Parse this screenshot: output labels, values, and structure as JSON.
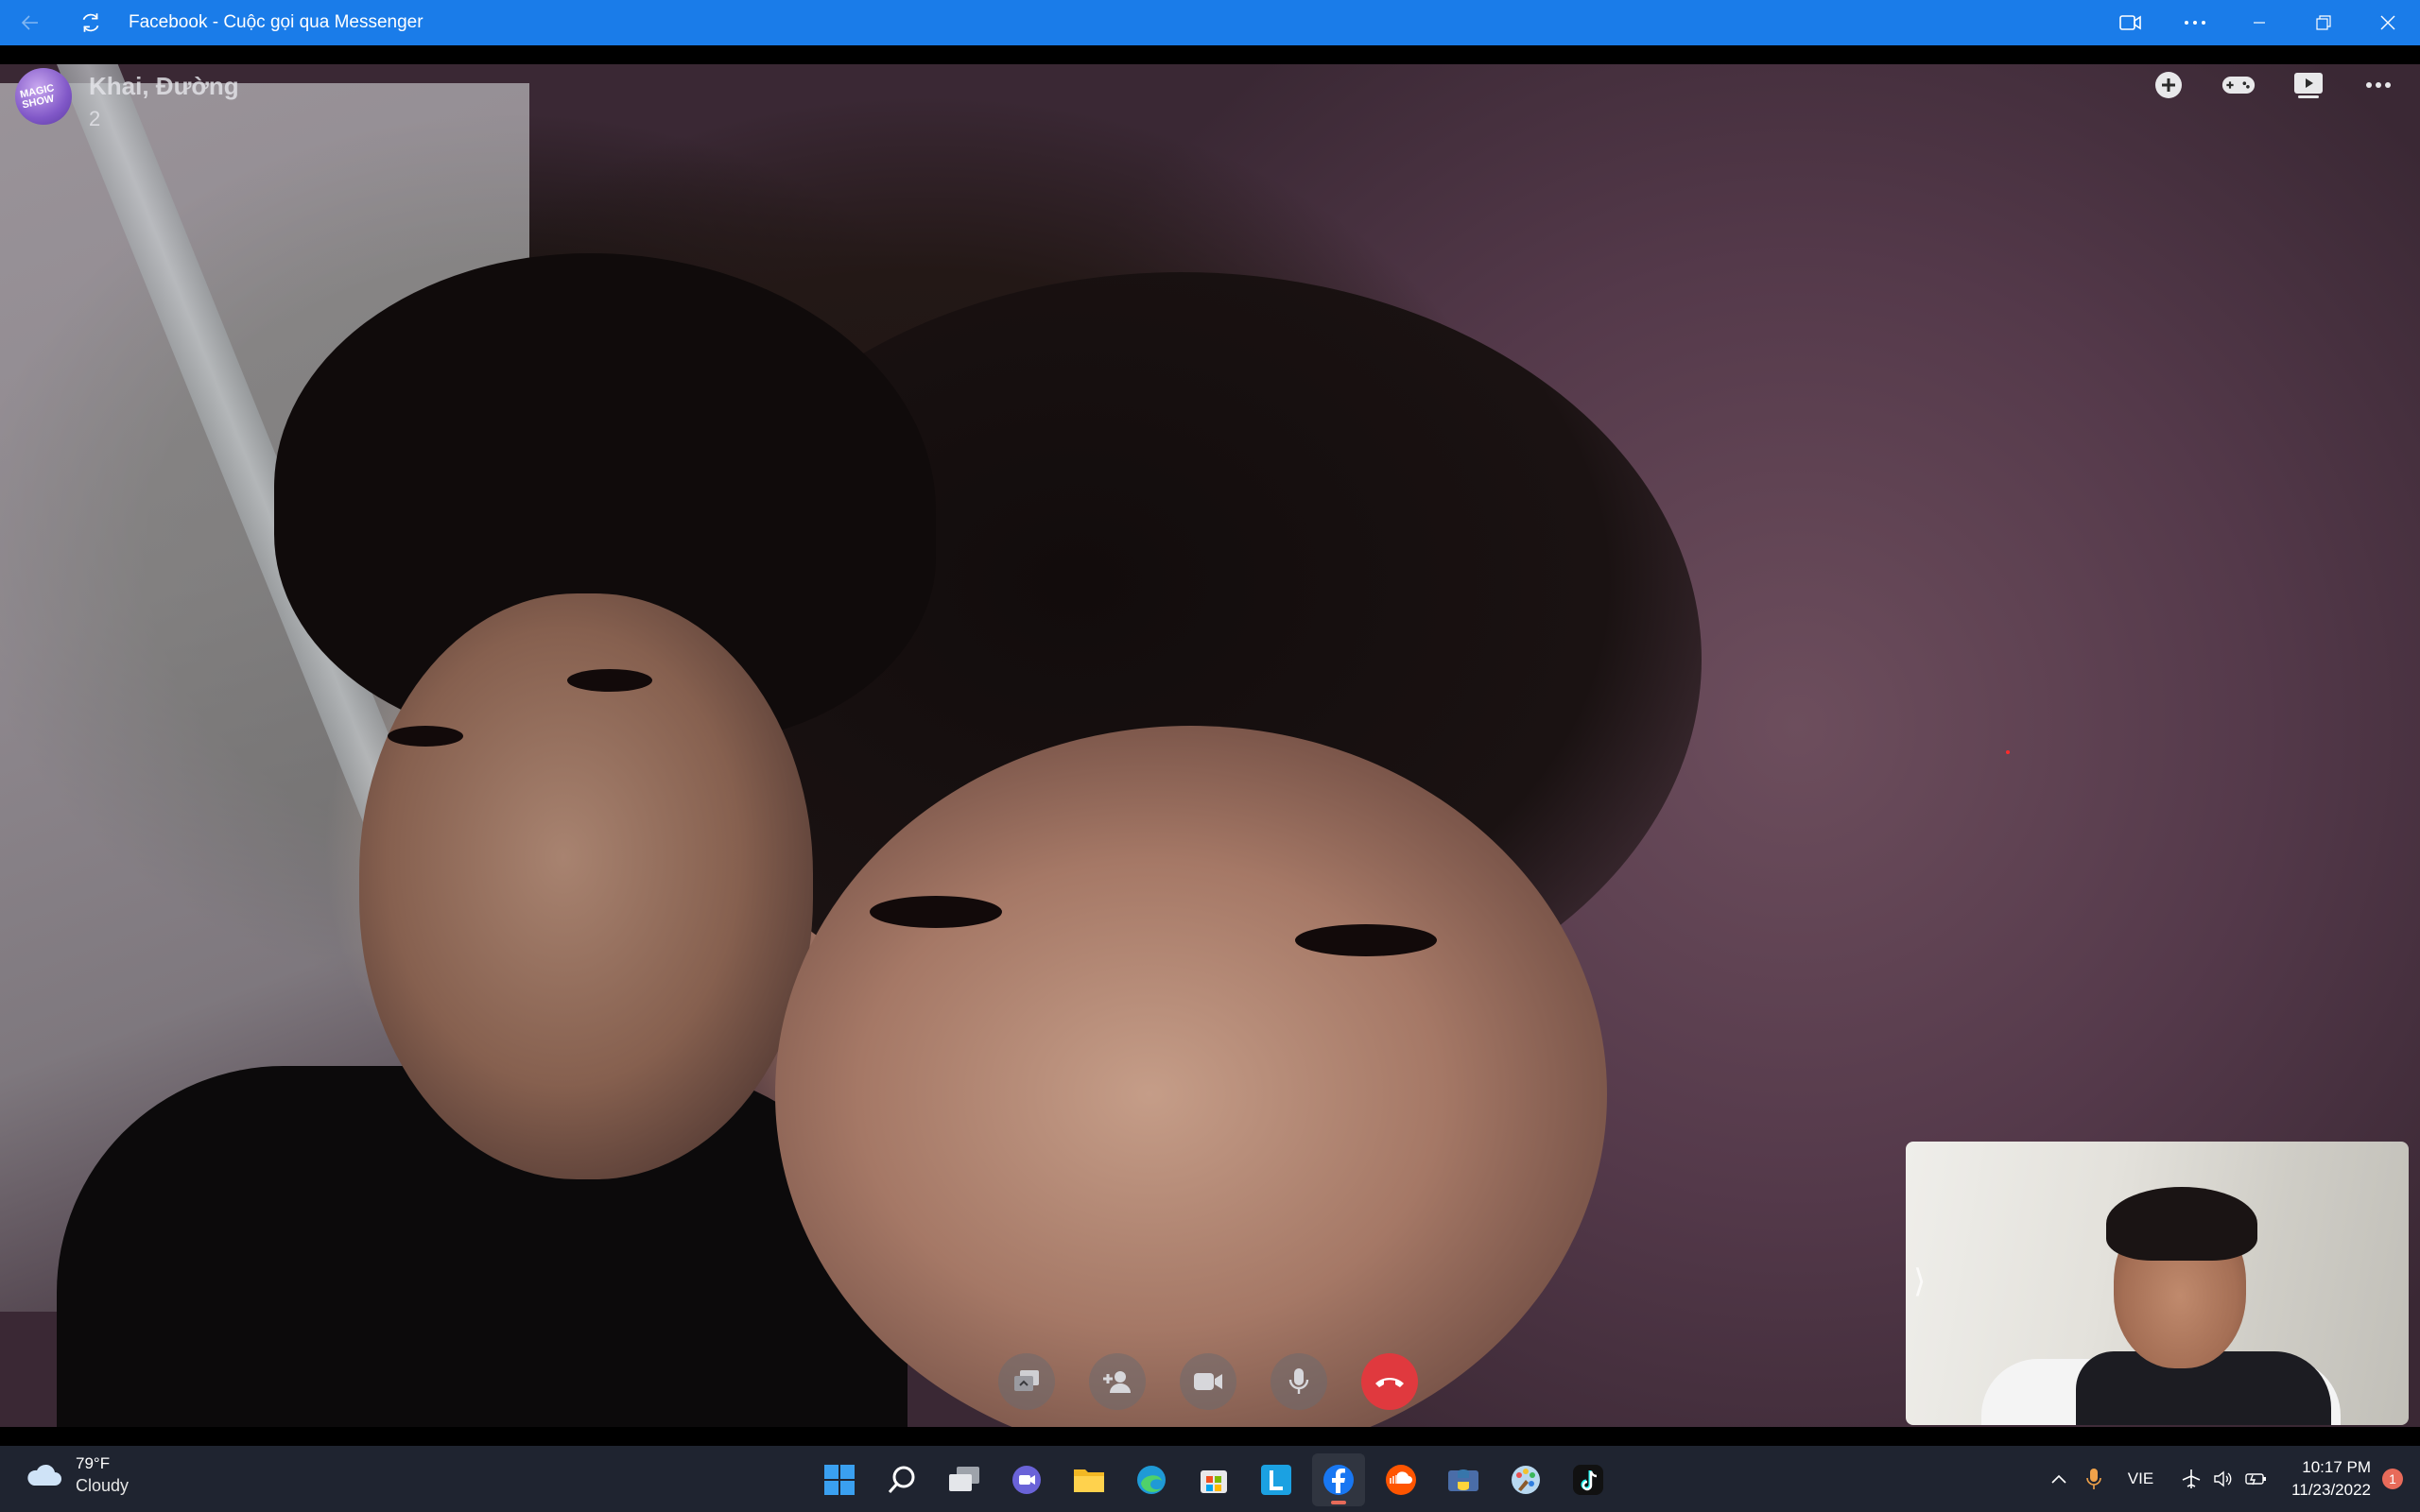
{
  "window": {
    "title": "Facebook - Cuộc gọi qua Messenger"
  },
  "call": {
    "title": "Khai, Đường",
    "participants": "2",
    "avatar_text": "MAGIC SHOW"
  },
  "taskbar": {
    "weather": {
      "temp": "79°F",
      "condition": "Cloudy"
    },
    "apps": [
      {
        "name": "start-icon"
      },
      {
        "name": "search-icon"
      },
      {
        "name": "task-view-icon"
      },
      {
        "name": "teams-chat-icon"
      },
      {
        "name": "file-explorer-icon"
      },
      {
        "name": "edge-icon"
      },
      {
        "name": "microsoft-store-icon"
      },
      {
        "name": "l-app-icon"
      },
      {
        "name": "facebook-icon"
      },
      {
        "name": "soundcloud-icon"
      },
      {
        "name": "python-icon"
      },
      {
        "name": "paint-icon"
      },
      {
        "name": "tiktok-icon"
      }
    ],
    "language": "VIE",
    "time": "10:17 PM",
    "date": "11/23/2022",
    "notification_count": "1"
  },
  "colors": {
    "titlebar": "#1a7ce9",
    "end_call": "#e0393e",
    "taskbar": "#1f2430"
  }
}
